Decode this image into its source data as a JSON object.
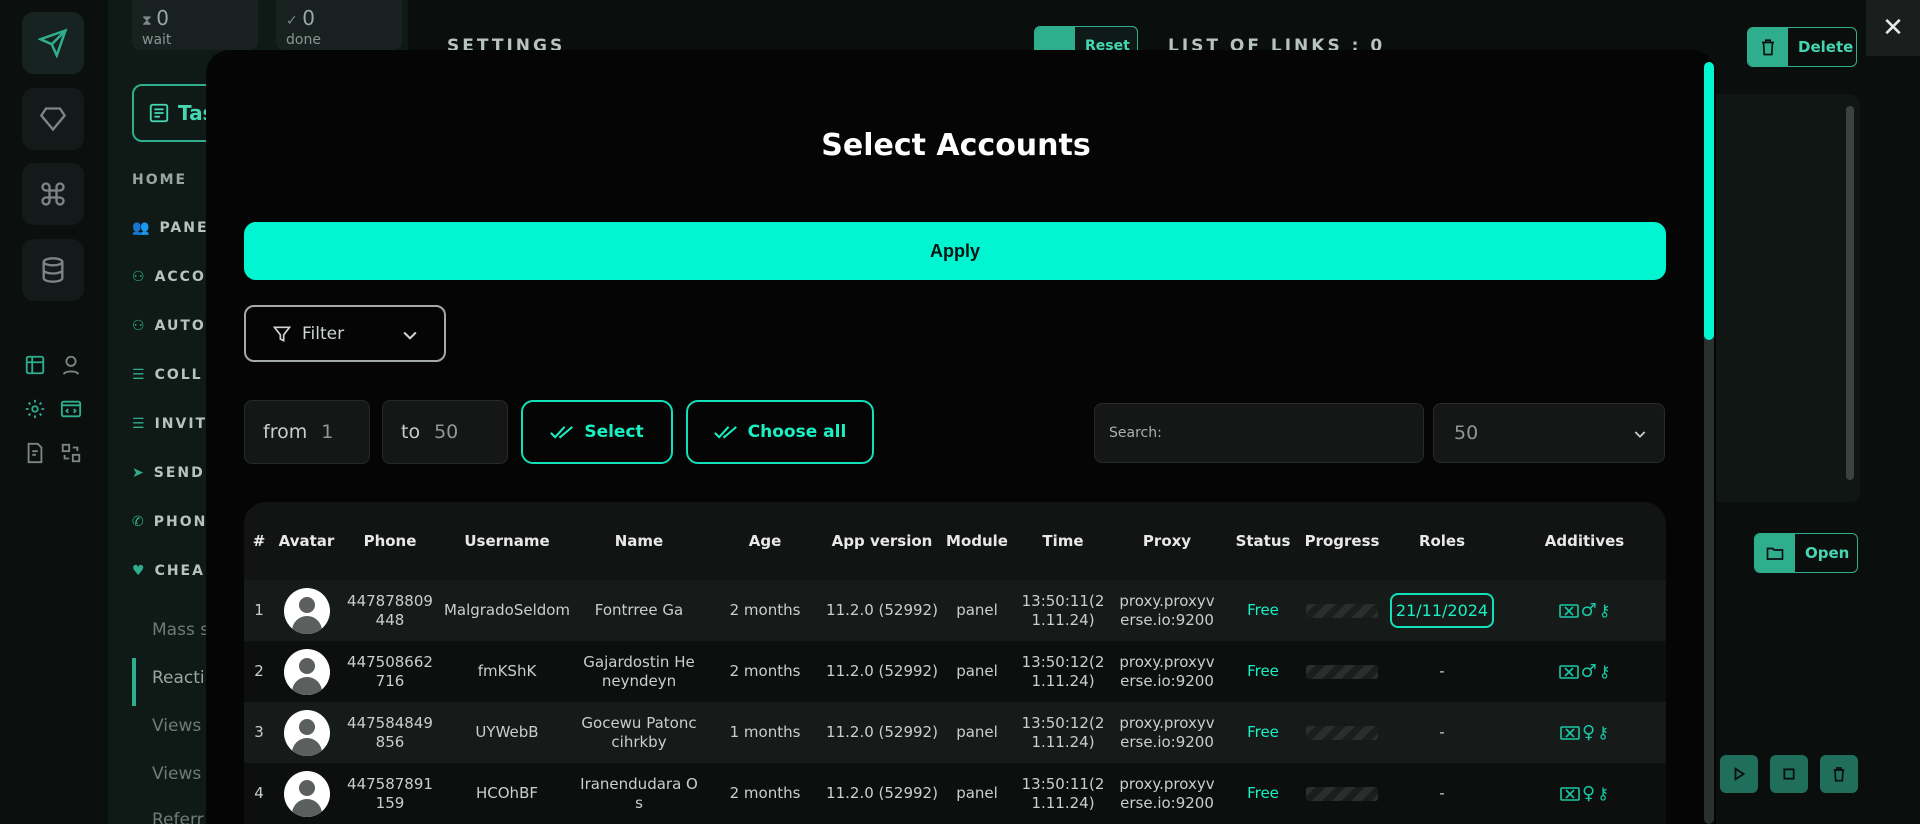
{
  "counters": [
    {
      "value": "0",
      "label": "wait"
    },
    {
      "value": "0",
      "label": "done"
    }
  ],
  "sidebar": {
    "tasks_label": "Tas",
    "home_label": "HOME",
    "items": [
      "PANEI",
      "ACCO",
      "AUTO",
      "COLL",
      "INVIT",
      "SEND",
      "PHON",
      "CHEA"
    ],
    "subitems": [
      "Mass s",
      "Reacti",
      "Views",
      "Views",
      "Referr"
    ]
  },
  "background": {
    "settings_label": "SETTINGS",
    "reset_label": "Reset",
    "links_label": "LIST OF LINKS : 0",
    "delete_label": "Delete",
    "open_label": "Open",
    "close_symbol": "✕"
  },
  "modal": {
    "title": "Select Accounts",
    "apply_label": "Apply",
    "filter_label": "Filter",
    "from_prefix": "from",
    "from_value": "1",
    "to_prefix": "to",
    "to_value": "50",
    "select_label": "Select",
    "choose_all_label": "Choose all",
    "search_placeholder": "Search:",
    "page_size": "50"
  },
  "table": {
    "columns": [
      "#",
      "Avatar",
      "Phone",
      "Username",
      "Name",
      "Age",
      "App version",
      "Module",
      "Time",
      "Proxy",
      "Status",
      "Progress",
      "Roles",
      "Additives"
    ],
    "rows": [
      {
        "num": "1",
        "phone": "447878809448",
        "username": "MalgradoSeldom",
        "name": "Fontrree Ga",
        "age": "2 months",
        "app": "11.2.0 (52992)",
        "module": "panel",
        "time": "13:50:11(21.11.24)",
        "proxy": "proxy.proxyverse.io:9200",
        "status": "Free",
        "roles": "21/11/2024",
        "gender": "♂",
        "key": "⚷"
      },
      {
        "num": "2",
        "phone": "447508662716",
        "username": "fmKShK",
        "name": "Gajardostin Heneyndeyn",
        "age": "2 months",
        "app": "11.2.0 (52992)",
        "module": "panel",
        "time": "13:50:12(21.11.24)",
        "proxy": "proxy.proxyverse.io:9200",
        "status": "Free",
        "roles": "-",
        "gender": "♂",
        "key": "⚷"
      },
      {
        "num": "3",
        "phone": "447584849856",
        "username": "UYWebB",
        "name": "Gocewu Patonccihrkby",
        "age": "1 months",
        "app": "11.2.0 (52992)",
        "module": "panel",
        "time": "13:50:12(21.11.24)",
        "proxy": "proxy.proxyverse.io:9200",
        "status": "Free",
        "roles": "-",
        "gender": "♀",
        "key": "⚷"
      },
      {
        "num": "4",
        "phone": "447587891159",
        "username": "HCOhBF",
        "name": "Iranendudara Os",
        "age": "2 months",
        "app": "11.2.0 (52992)",
        "module": "panel",
        "time": "13:50:11(21.11.24)",
        "proxy": "proxy.proxyverse.io:9200",
        "status": "Free",
        "roles": "-",
        "gender": "♀",
        "key": "⚷"
      }
    ]
  }
}
